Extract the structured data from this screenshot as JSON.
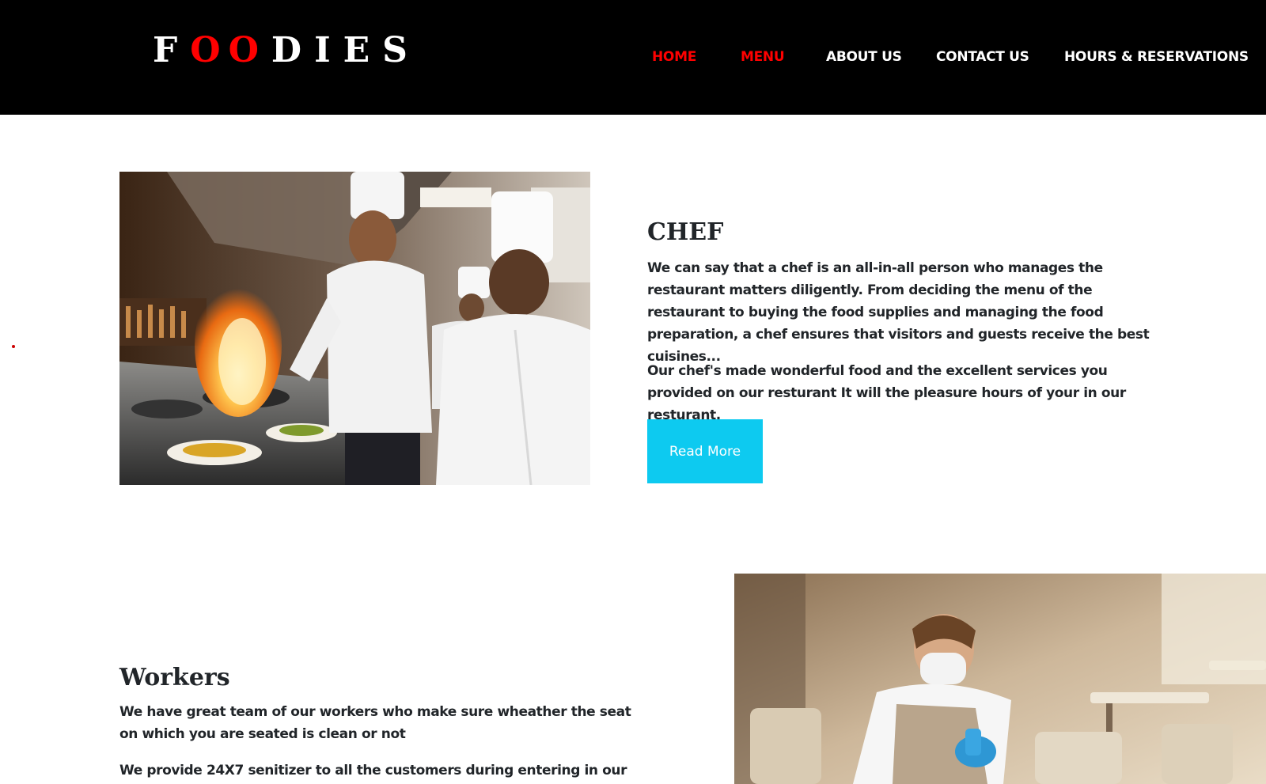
{
  "brand": {
    "logo_part1": "F",
    "logo_part2": "OO",
    "logo_part3": "DIES",
    "accent_color": "#ff0000"
  },
  "nav": {
    "items": [
      {
        "label": "HOME",
        "active": true
      },
      {
        "label": "MENU",
        "active": true
      },
      {
        "label": "ABOUT US",
        "active": false
      },
      {
        "label": "CONTACT US",
        "active": false
      },
      {
        "label": "HOURS & RESERVATIONS",
        "active": false
      }
    ]
  },
  "chef": {
    "title": "CHEF",
    "paragraph1": "We can say that a chef is an all-in-all person who manages the restaurant matters diligently. From deciding the menu of the restaurant to buying the food supplies and managing the food preparation, a chef ensures that visitors and guests receive the best cuisines...",
    "paragraph2": "Our chef's made wonderful food and the excellent services you provided on our resturant It will the pleasure hours of your in our resturant.",
    "button_label": "Read More",
    "button_color": "#0dcaf0"
  },
  "workers": {
    "title": "Workers",
    "paragraph1": "We have great team of our workers who make sure wheather the seat on which you are seated is clean or not",
    "paragraph2": "We provide 24X7 senitizer to all the customers during entering in our"
  }
}
